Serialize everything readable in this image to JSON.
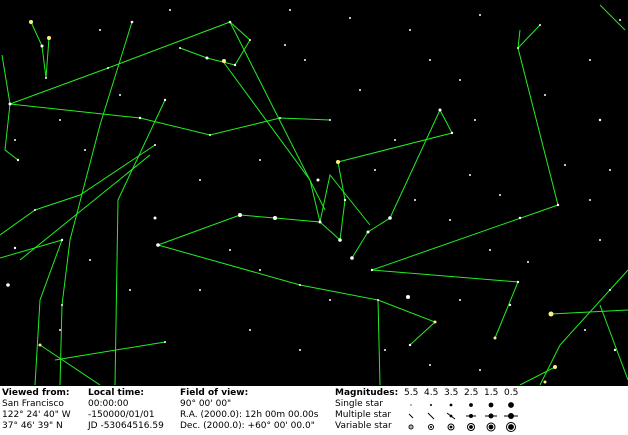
{
  "info": {
    "viewed_from": {
      "label": "Viewed from:",
      "place": "San Francisco",
      "longitude": "122° 24' 40\" W",
      "latitude": "37° 46' 39\" N"
    },
    "local_time": {
      "label": "Local time:",
      "time": "00:00:00",
      "date": "-150000/01/01",
      "jd": "JD -53064516.59"
    },
    "field_of_view": {
      "label": "Field of view:",
      "fov": "90° 00' 00\"",
      "ra": "R.A. (2000.0): 12h 00m 00.00s",
      "dec": "Dec. (2000.0): +60° 00' 00.0\""
    },
    "magnitudes": {
      "label": "Magnitudes:",
      "values": [
        "5.5",
        "4.5",
        "3.5",
        "2.5",
        "1.5",
        "0.5"
      ],
      "rows": [
        {
          "label": "Single star",
          "icon": "single-star-icon"
        },
        {
          "label": "Multiple star",
          "icon": "multiple-star-icon"
        },
        {
          "label": "Variable star",
          "icon": "variable-star-icon"
        }
      ]
    }
  },
  "colors": {
    "sky": "#000000",
    "constellation": "#22ee22",
    "star": "#ffffff",
    "bright_star": "#ffee88",
    "info_bg": "#ffffff"
  }
}
